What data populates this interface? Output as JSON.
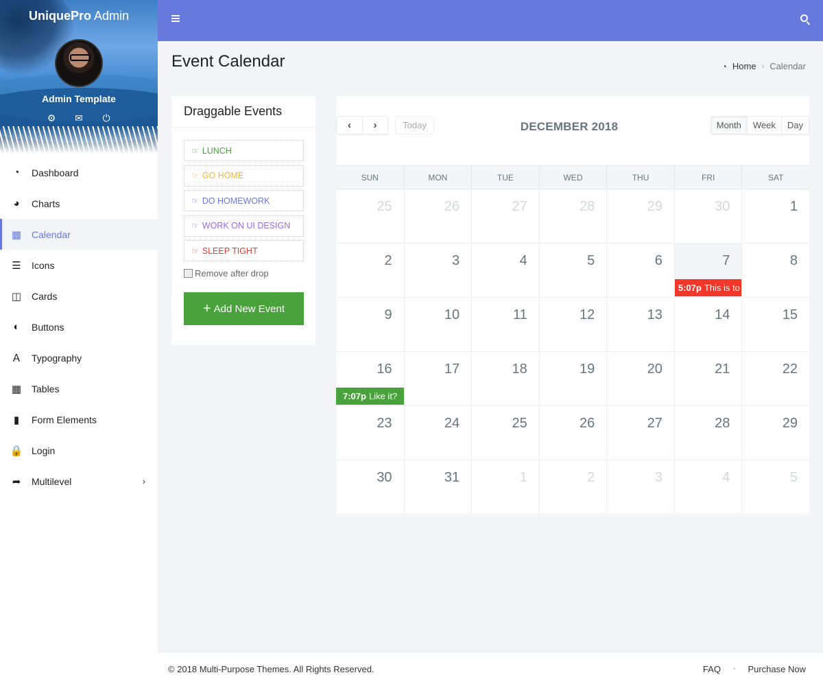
{
  "sidebar": {
    "brand_bold": "UniquePro",
    "brand_light": " Admin",
    "profile_name": "Admin Template",
    "profile_actions": [
      {
        "icon": "gear-icon",
        "glyph": "⚙"
      },
      {
        "icon": "envelope-icon",
        "glyph": "✉"
      },
      {
        "icon": "power-icon",
        "glyph": "⏻"
      }
    ],
    "items": [
      {
        "label": "Dashboard",
        "icon": "dashboard-icon",
        "glyph": "◔"
      },
      {
        "label": "Charts",
        "icon": "pie-chart-icon",
        "glyph": "◕"
      },
      {
        "label": "Calendar",
        "icon": "calendar-icon",
        "glyph": "▦",
        "active": true
      },
      {
        "label": "Icons",
        "icon": "bars-icon",
        "glyph": "☰"
      },
      {
        "label": "Cards",
        "icon": "columns-icon",
        "glyph": "◫"
      },
      {
        "label": "Buttons",
        "icon": "adjust-icon",
        "glyph": "◐"
      },
      {
        "label": "Typography",
        "icon": "language-icon",
        "glyph": "Ａ"
      },
      {
        "label": "Tables",
        "icon": "table-icon",
        "glyph": "▦"
      },
      {
        "label": "Form Elements",
        "icon": "file-icon",
        "glyph": "▮"
      },
      {
        "label": "Login",
        "icon": "lock-icon",
        "glyph": "🔒"
      },
      {
        "label": "Multilevel",
        "icon": "share-icon",
        "glyph": "➦",
        "has_children": true
      }
    ]
  },
  "topbar": {
    "menu_icon": "hamburger-icon",
    "search_icon": "search-icon"
  },
  "page": {
    "title": "Event Calendar",
    "breadcrumb": [
      {
        "label": "Home",
        "icon": "dashboard-icon"
      },
      {
        "label": "Calendar"
      }
    ]
  },
  "draggable": {
    "title": "Draggable Events",
    "events": [
      {
        "label": "LUNCH",
        "color": "#4aa23d"
      },
      {
        "label": "GO HOME",
        "color": "#f4b334"
      },
      {
        "label": "DO HOMEWORK",
        "color": "#6779de"
      },
      {
        "label": "WORK ON UI DESIGN",
        "color": "#9a6bdd"
      },
      {
        "label": "SLEEP TIGHT",
        "color": "#f0372a"
      }
    ],
    "remove_after_drop_label": "Remove after drop",
    "remove_after_drop_checked": false,
    "add_button_label": "Add New Event"
  },
  "calendar": {
    "title": "DECEMBER 2018",
    "prev_label": "‹",
    "next_label": "›",
    "today_label": "Today",
    "views": [
      {
        "label": "Month",
        "active": true
      },
      {
        "label": "Week"
      },
      {
        "label": "Day"
      }
    ],
    "weekdays": [
      "SUN",
      "MON",
      "TUE",
      "WED",
      "THU",
      "FRI",
      "SAT"
    ],
    "weeks": [
      [
        {
          "d": 25,
          "other": true
        },
        {
          "d": 26,
          "other": true
        },
        {
          "d": 27,
          "other": true
        },
        {
          "d": 28,
          "other": true
        },
        {
          "d": 29,
          "other": true
        },
        {
          "d": 30,
          "other": true
        },
        {
          "d": 1
        }
      ],
      [
        {
          "d": 2
        },
        {
          "d": 3
        },
        {
          "d": 4
        },
        {
          "d": 5
        },
        {
          "d": 6
        },
        {
          "d": 7,
          "today": true
        },
        {
          "d": 8
        }
      ],
      [
        {
          "d": 9
        },
        {
          "d": 10
        },
        {
          "d": 11
        },
        {
          "d": 12
        },
        {
          "d": 13
        },
        {
          "d": 14
        },
        {
          "d": 15
        }
      ],
      [
        {
          "d": 16
        },
        {
          "d": 17
        },
        {
          "d": 18
        },
        {
          "d": 19
        },
        {
          "d": 20
        },
        {
          "d": 21
        },
        {
          "d": 22
        }
      ],
      [
        {
          "d": 23
        },
        {
          "d": 24
        },
        {
          "d": 25
        },
        {
          "d": 26
        },
        {
          "d": 27
        },
        {
          "d": 28
        },
        {
          "d": 29
        }
      ],
      [
        {
          "d": 30
        },
        {
          "d": 31
        },
        {
          "d": 1,
          "other": true
        },
        {
          "d": 2,
          "other": true
        },
        {
          "d": 3,
          "other": true
        },
        {
          "d": 4,
          "other": true
        },
        {
          "d": 5,
          "other": true
        }
      ]
    ],
    "events": [
      {
        "week": 1,
        "day": 5,
        "time": "5:07p",
        "title": "This is to",
        "color": "red"
      },
      {
        "week": 3,
        "day": 0,
        "time": "7:07p",
        "title": "Like it?",
        "color": "green"
      }
    ]
  },
  "footer": {
    "copyright": "© 2018 Multi-Purpose Themes. All Rights Reserved.",
    "links": [
      "FAQ",
      "Purchase Now"
    ]
  }
}
